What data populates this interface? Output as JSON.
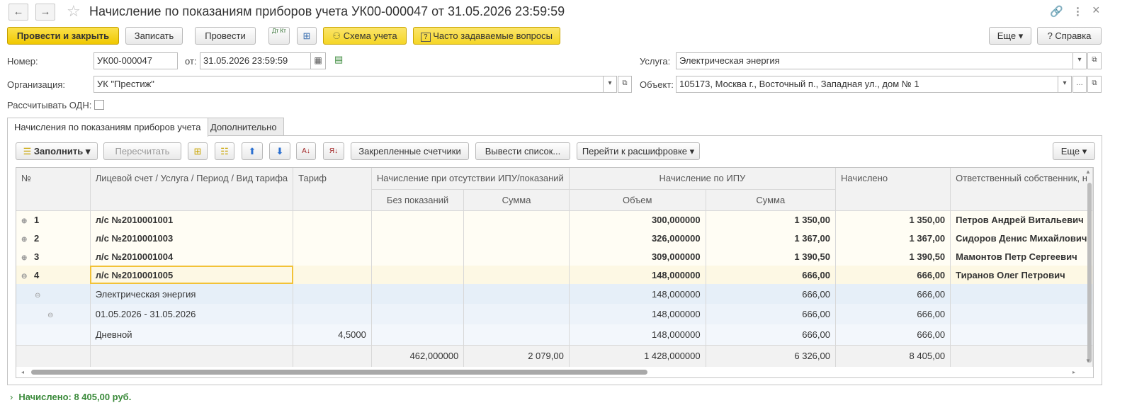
{
  "window": {
    "title": "Начисление по показаниям приборов учета УК00-000047 от 31.05.2026 23:59:59",
    "back": "←",
    "forward": "→",
    "star": "☆",
    "link_icon": "🔗",
    "more_icon": "⋮",
    "close_icon": "×"
  },
  "toolbar": {
    "post_close": "Провести и закрыть",
    "save": "Записать",
    "post": "Провести",
    "dt_kt": "Дт Кт",
    "scheme": "Схема учета",
    "faq": "Часто задаваемые вопросы",
    "more": "Еще ▾",
    "help": "? Справка"
  },
  "form": {
    "number_label": "Номер:",
    "number": "УК00-000047",
    "from_label": "от:",
    "date": "31.05.2026 23:59:59",
    "org_label": "Организация:",
    "org": "УК \"Престиж\"",
    "odn_label": "Рассчитывать ОДН:",
    "service_label": "Услуга:",
    "service": "Электрическая энергия",
    "object_label": "Объект:",
    "object": "105173, Москва г., Восточный п., Западная ул., дом № 1"
  },
  "tabs": [
    "Начисления по показаниям приборов учета",
    "Дополнительно"
  ],
  "grid_toolbar": {
    "fill": "Заполнить ▾",
    "recalc": "Пересчитать",
    "pinned": "Закрепленные счетчики",
    "export": "Вывести список...",
    "goto": "Перейти к расшифровке ▾",
    "more": "Еще ▾"
  },
  "table": {
    "headers": {
      "num": "№",
      "account": "Лицевой счет / Услуга / Период / Вид тарифа",
      "tariff": "Тариф",
      "absent": "Начисление при отсутствии ИПУ/показаний",
      "no_readings": "Без показаний",
      "sum1": "Сумма",
      "ipu": "Начисление по ИПУ",
      "volume": "Объем",
      "sum2": "Сумма",
      "charged": "Начислено",
      "owner": "Ответственный собственник, н"
    },
    "rows": [
      {
        "exp": "⊕",
        "num": "1",
        "account": "л/с №2010001001",
        "tariff": "",
        "no_readings": "",
        "sum1": "",
        "volume": "300,000000",
        "sum2": "1 350,00",
        "charged": "1 350,00",
        "owner": "Петров Андрей Витальевич"
      },
      {
        "exp": "⊕",
        "num": "2",
        "account": "л/с №2010001003",
        "tariff": "",
        "no_readings": "",
        "sum1": "",
        "volume": "326,000000",
        "sum2": "1 367,00",
        "charged": "1 367,00",
        "owner": "Сидоров Денис Михайлович"
      },
      {
        "exp": "⊕",
        "num": "3",
        "account": "л/с №2010001004",
        "tariff": "",
        "no_readings": "",
        "sum1": "",
        "volume": "309,000000",
        "sum2": "1 390,50",
        "charged": "1 390,50",
        "owner": "Мамонтов Петр Сергеевич"
      },
      {
        "exp": "⊖",
        "num": "4",
        "account": "л/с №2010001005",
        "tariff": "",
        "no_readings": "",
        "sum1": "",
        "volume": "148,000000",
        "sum2": "666,00",
        "charged": "666,00",
        "owner": "Тиранов Олег Петрович"
      }
    ],
    "sub": [
      {
        "exp": "⊖",
        "account": "Электрическая энергия",
        "tariff": "",
        "volume": "148,000000",
        "sum2": "666,00",
        "charged": "666,00"
      },
      {
        "exp": "⊖",
        "account": "01.05.2026 - 31.05.2026",
        "tariff": "",
        "volume": "148,000000",
        "sum2": "666,00",
        "charged": "666,00"
      },
      {
        "exp": "",
        "account": "Дневной",
        "tariff": "4,5000",
        "volume": "148,000000",
        "sum2": "666,00",
        "charged": "666,00"
      }
    ],
    "footer": {
      "no_readings": "462,000000",
      "sum1": "2 079,00",
      "volume": "1 428,000000",
      "sum2": "6 326,00",
      "charged": "8 405,00"
    }
  },
  "status": "Начислено: 8 405,00 руб.",
  "status_arrow": "›"
}
